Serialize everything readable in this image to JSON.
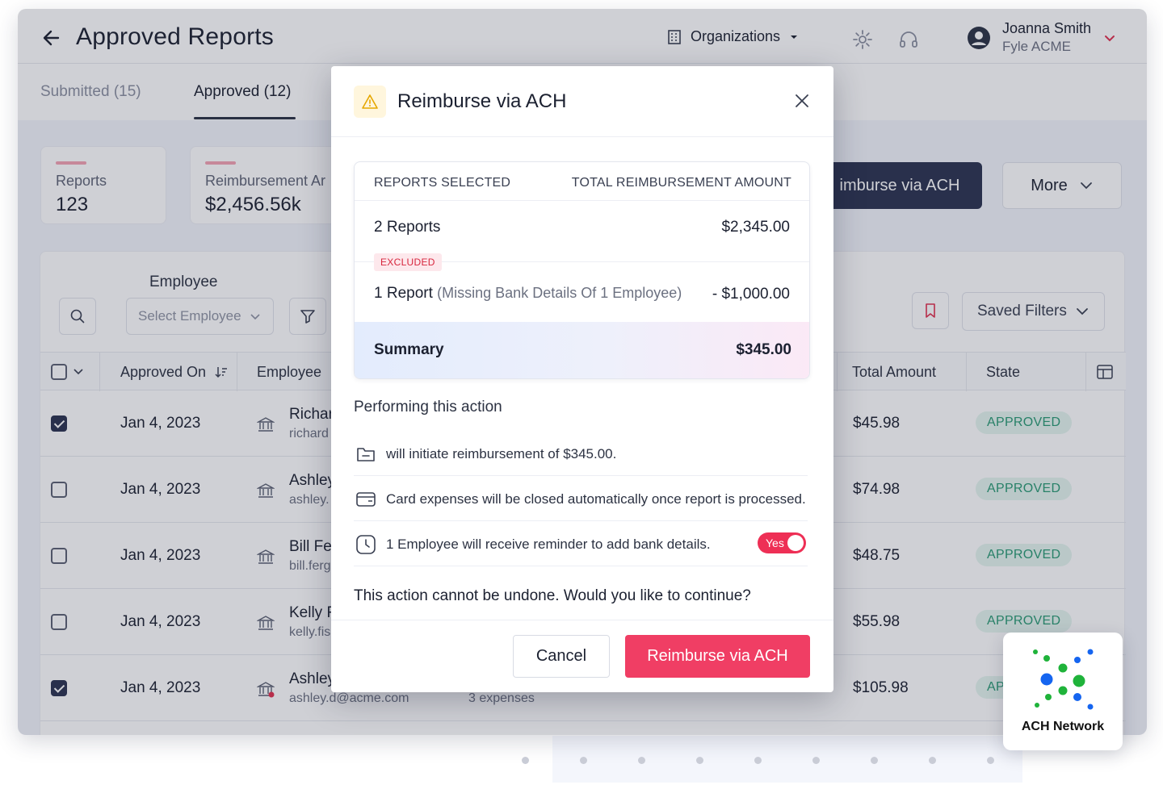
{
  "header": {
    "title": "Approved Reports",
    "org_label": "Organizations",
    "user_name": "Joanna Smith",
    "user_org": "Fyle ACME"
  },
  "tabs": [
    {
      "label": "Submitted (15)",
      "active": false
    },
    {
      "label": "Approved (12)",
      "active": true
    }
  ],
  "stats": [
    {
      "label": "Reports",
      "value": "123"
    },
    {
      "label": "Reimbursement Ar",
      "value": "$2,456.56k"
    }
  ],
  "actions": {
    "primary_label": "imburse via ACH",
    "more_label": "More"
  },
  "filters": {
    "employee_label": "Employee",
    "employee_placeholder": "Select Employee",
    "saved_filters_label": "Saved Filters"
  },
  "table": {
    "headers": {
      "approved_on": "Approved On",
      "employee": "Employee",
      "total_amount": "Total Amount",
      "state": "State"
    },
    "rows": [
      {
        "checked": true,
        "date": "Jan 4, 2023",
        "name": "Richar",
        "email": "richard",
        "amount": "$45.98",
        "state": "APPROVED",
        "expenses": ""
      },
      {
        "checked": false,
        "date": "Jan 4, 2023",
        "name": "Ashley",
        "email": "ashley.",
        "amount": "$74.98",
        "state": "APPROVED",
        "expenses": ""
      },
      {
        "checked": false,
        "date": "Jan 4, 2023",
        "name": "Bill Fer",
        "email": "bill.ferg",
        "amount": "$48.75",
        "state": "APPROVED",
        "expenses": ""
      },
      {
        "checked": false,
        "date": "Jan 4, 2023",
        "name": "Kelly F",
        "email": "kelly.fis",
        "amount": "$55.98",
        "state": "APPROVED",
        "expenses": ""
      },
      {
        "checked": true,
        "date": "Jan 4, 2023",
        "name": "Ashley",
        "email": "ashley.d@acme.com",
        "amount": "$105.98",
        "state": "AP",
        "expenses": "3 expenses"
      }
    ]
  },
  "modal": {
    "title": "Reimburse via ACH",
    "card": {
      "col_left": "REPORTS SELECTED",
      "col_right": "TOTAL REIMBURSEMENT AMOUNT",
      "selected_label": "2 Reports",
      "selected_amount": "$2,345.00",
      "excluded_badge": "EXCLUDED",
      "excluded_label": "1 Report",
      "excluded_reason": "(Missing Bank Details Of 1 Employee)",
      "excluded_amount": "- $1,000.00",
      "summary_label": "Summary",
      "summary_amount": "$345.00"
    },
    "performing_label": "Performing this action",
    "effects": [
      {
        "icon": "folder-icon",
        "text": "will initiate reimbursement of $345.00."
      },
      {
        "icon": "card-icon",
        "text": "Card expenses will be closed automatically once report is processed."
      },
      {
        "icon": "clock-icon",
        "text": "1 Employee will receive reminder to add bank details.",
        "toggle": "Yes"
      }
    ],
    "confirm_text": "This action cannot be undone. Would you like to continue?",
    "cancel_label": "Cancel",
    "submit_label": "Reimburse via ACH"
  },
  "ach_badge": {
    "label": "ACH Network"
  },
  "colors": {
    "accent": "#f03e64",
    "dark_button": "#2b3350",
    "approved_text": "#2a9a74",
    "approved_bg": "#e4f5ef"
  }
}
